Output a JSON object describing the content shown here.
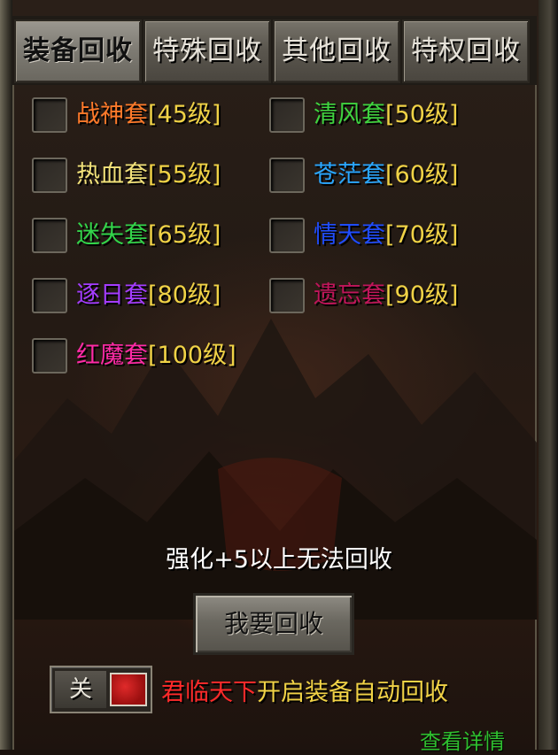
{
  "tabs": [
    {
      "label": "装备回收",
      "active": true
    },
    {
      "label": "特殊回收",
      "active": false
    },
    {
      "label": "其他回收",
      "active": false
    },
    {
      "label": "特权回收",
      "active": false
    }
  ],
  "sets": [
    {
      "name": "战神套",
      "level": "[45级]",
      "color": "#ff7a2a",
      "checked": false
    },
    {
      "name": "清风套",
      "level": "[50级]",
      "color": "#3fd43f",
      "checked": false
    },
    {
      "name": "热血套",
      "level": "[55级]",
      "color": "#f2e27a",
      "checked": false
    },
    {
      "name": "苍茫套",
      "level": "[60级]",
      "color": "#2aa6ff",
      "checked": false
    },
    {
      "name": "迷失套",
      "level": "[65级]",
      "color": "#33d44a",
      "checked": false
    },
    {
      "name": "情天套",
      "level": "[70级]",
      "color": "#1f4cff",
      "checked": false
    },
    {
      "name": "逐日套",
      "level": "[80级]",
      "color": "#a43cff",
      "checked": false
    },
    {
      "name": "遗忘套",
      "level": "[90级]",
      "color": "#c0155a",
      "checked": false
    },
    {
      "name": "红魔套",
      "level": "[100级]",
      "color": "#ff2aa6",
      "checked": false
    }
  ],
  "warning": "强化+5以上无法回收",
  "recycle_button": "我要回收",
  "auto_recycle": {
    "toggle_label": "关",
    "enabled": false,
    "privilege": "君临天下",
    "privilege_color": "#ff2a2a",
    "text": "开启装备自动回收",
    "text_color": "#f0d246"
  },
  "detail_link": "查看详情"
}
